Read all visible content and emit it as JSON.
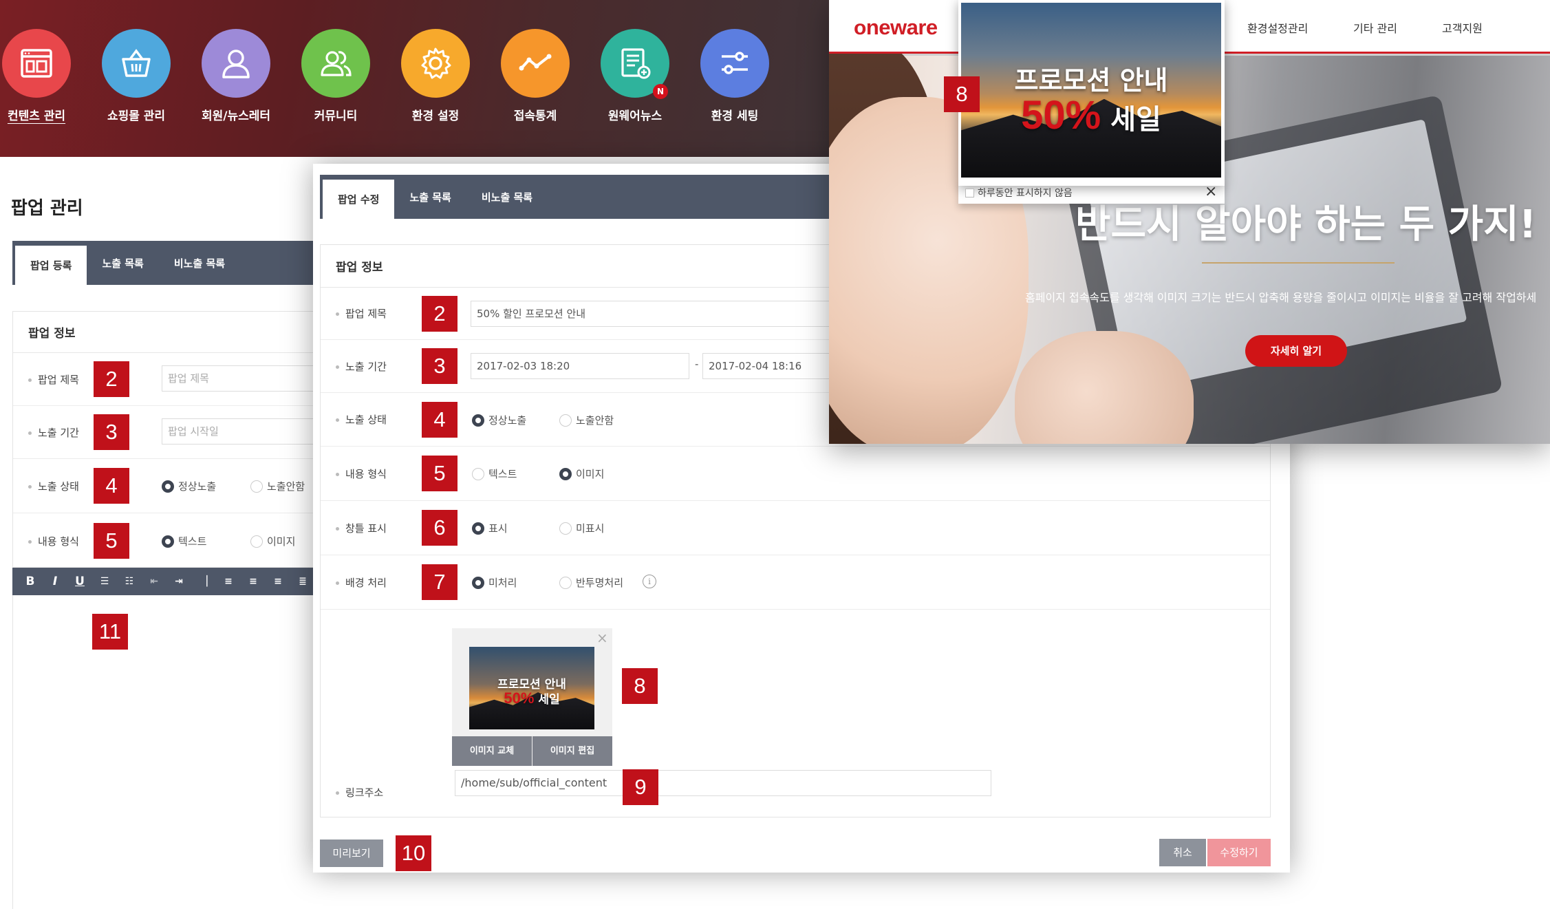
{
  "topnav": {
    "items": [
      {
        "label": "컨텐츠 관리",
        "icon": "content-icon",
        "color": "#e8474b",
        "active": true
      },
      {
        "label": "쇼핑몰 관리",
        "icon": "basket-icon",
        "color": "#4fa8dd"
      },
      {
        "label": "회원/뉴스레터",
        "icon": "user-icon",
        "color": "#9d8ad8"
      },
      {
        "label": "커뮤니티",
        "icon": "community-icon",
        "color": "#6fc24c"
      },
      {
        "label": "환경 설정",
        "icon": "gear-icon",
        "color": "#f7a92c"
      },
      {
        "label": "접속통계",
        "icon": "stats-icon",
        "color": "#f6962b"
      },
      {
        "label": "원웨어뉴스",
        "icon": "news-icon",
        "color": "#2fb39c",
        "badge": "N"
      },
      {
        "label": "환경 세팅",
        "icon": "sliders-icon",
        "color": "#5c7ee0"
      }
    ]
  },
  "back": {
    "title": "팝업 관리",
    "tabs": [
      "팝업 등록",
      "노출 목록",
      "비노출 목록"
    ],
    "section": "팝업 정보",
    "rows": {
      "title": {
        "label": "팝업 제목",
        "placeholder": "팝업 제목",
        "marker": "2"
      },
      "period": {
        "label": "노출 기간",
        "placeholder": "팝업 시작일",
        "marker": "3"
      },
      "status": {
        "label": "노출 상태",
        "opt1": "정상노출",
        "opt2": "노출안함",
        "marker": "4"
      },
      "format": {
        "label": "내용 형식",
        "opt1": "텍스트",
        "opt2": "이미지",
        "marker": "5"
      }
    },
    "editor_marker": "11"
  },
  "mid": {
    "tabs": [
      "팝업 수정",
      "노출 목록",
      "비노출 목록"
    ],
    "section": "팝업 정보",
    "rows": {
      "title": {
        "label": "팝업 제목",
        "value": "50% 할인 프로모션 안내",
        "marker": "2"
      },
      "period": {
        "label": "노출 기간",
        "start": "2017-02-03 18:20",
        "sep": "-",
        "end": "2017-02-04 18:16",
        "marker": "3"
      },
      "status": {
        "label": "노출 상태",
        "opt1": "정상노출",
        "opt2": "노출안함",
        "marker": "4"
      },
      "format": {
        "label": "내용 형식",
        "opt1": "텍스트",
        "opt2": "이미지",
        "marker": "5"
      },
      "window": {
        "label": "창틀 표시",
        "opt1": "표시",
        "opt2": "미표시",
        "marker": "6"
      },
      "background": {
        "label": "배경 처리",
        "opt1": "미처리",
        "opt2": "반투명처리",
        "marker": "7"
      },
      "image": {
        "marker": "8",
        "replace": "이미지 교체",
        "edit": "이미지 편집",
        "promo_title": "프로모션 안내",
        "promo_pct": "50%",
        "promo_sale": "세일"
      },
      "link": {
        "label": "링크주소",
        "value": "/home/sub/official_content",
        "marker": "9"
      }
    },
    "buttons": {
      "preview": "미리보기",
      "preview_marker": "10",
      "cancel": "취소",
      "save": "수정하기"
    }
  },
  "site": {
    "logo_o": "o",
    "logo_rest": "neware",
    "nav": [
      "환경설정관리",
      "기타 관리",
      "고객지원"
    ],
    "hero_title": "반드시 알아야 하는 두 가지!",
    "hero_sub": "홈페이지 접속속도를 생각해 이미지 크기는 반드시 압축해 용량을 줄이시고 이미지는 비율을 잘 고려해 작업하세",
    "hero_btn": "자세히 알기",
    "popup": {
      "marker": "8",
      "promo_title": "프로모션 안내",
      "promo_pct": "50%",
      "promo_sale": "세일",
      "checkbox": "하루동안 표시하지 않음"
    }
  },
  "colors": {
    "marker": "#c0111a",
    "tabbar": "#4e5768",
    "brand_red": "#d01e26"
  }
}
